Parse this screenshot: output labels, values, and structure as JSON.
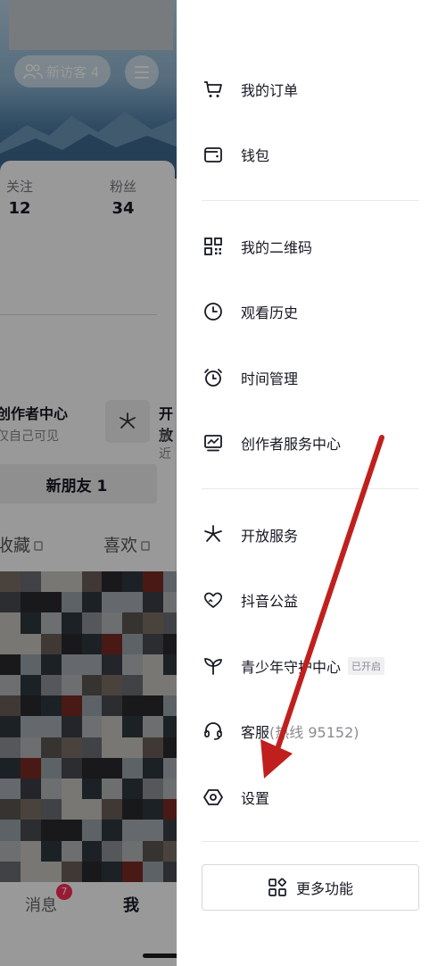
{
  "background": {
    "visitor_label": "新访客 4",
    "stats": [
      {
        "label": "关注",
        "value": "12"
      },
      {
        "label": "粉丝",
        "value": "34"
      }
    ],
    "creator_title": "创作者中心",
    "creator_sub": "仅自己可见",
    "open_title": "开放",
    "open_sub": "最近",
    "new_friend": "新朋友 1",
    "tabs": {
      "collect": "收藏",
      "like": "喜欢"
    },
    "nav": {
      "messages": "消息",
      "me": "我",
      "badge": "7"
    }
  },
  "drawer": {
    "items": [
      {
        "label": "我的订单",
        "icon": "cart-icon"
      },
      {
        "label": "钱包",
        "icon": "wallet-icon"
      },
      {
        "label": "我的二维码",
        "icon": "qrcode-icon"
      },
      {
        "label": "观看历史",
        "icon": "clock-icon"
      },
      {
        "label": "时间管理",
        "icon": "alarm-icon"
      },
      {
        "label": "创作者服务中心",
        "icon": "chart-icon"
      },
      {
        "label": "开放服务",
        "icon": "sparkle-icon"
      },
      {
        "label": "抖音公益",
        "icon": "heart-hands-icon"
      },
      {
        "label": "青少年守护中心",
        "icon": "sprout-icon",
        "tag": "已开启"
      },
      {
        "label": "客服",
        "hint": "(热线 95152)",
        "icon": "headset-icon"
      },
      {
        "label": "设置",
        "icon": "settings-icon"
      }
    ],
    "more_label": "更多功能"
  },
  "colors": {
    "arrow": "#c0201d",
    "accent": "#fe2c55"
  }
}
